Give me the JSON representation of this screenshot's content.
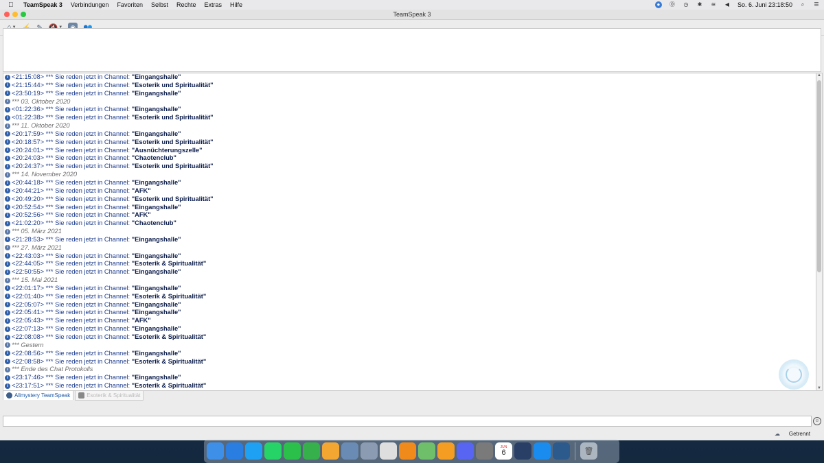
{
  "menubar": {
    "app_name": "TeamSpeak 3",
    "items": [
      "Verbindungen",
      "Favoriten",
      "Selbst",
      "Rechte",
      "Extras",
      "Hilfe"
    ],
    "datetime": "So. 6. Juni  23:18:50"
  },
  "window": {
    "title": "TeamSpeak 3"
  },
  "log": [
    {
      "time": "<21:15:08>",
      "text": "*** Sie reden jetzt in Channel: ",
      "channel": "\"Eingangshalle\""
    },
    {
      "time": "<21:15:44>",
      "text": "*** Sie reden jetzt in Channel: ",
      "channel": "\"Esoterik und Spiritualität\""
    },
    {
      "time": "<23:50:19>",
      "text": "*** Sie reden jetzt in Channel: ",
      "channel": "\"Eingangshalle\""
    },
    {
      "sep": "*** 03. Oktober 2020"
    },
    {
      "time": "<01:22:36>",
      "text": "*** Sie reden jetzt in Channel: ",
      "channel": "\"Eingangshalle\""
    },
    {
      "time": "<01:22:38>",
      "text": "*** Sie reden jetzt in Channel: ",
      "channel": "\"Esoterik und Spiritualität\""
    },
    {
      "sep": "*** 11. Oktober 2020"
    },
    {
      "time": "<20:17:59>",
      "text": "*** Sie reden jetzt in Channel: ",
      "channel": "\"Eingangshalle\""
    },
    {
      "time": "<20:18:57>",
      "text": "*** Sie reden jetzt in Channel: ",
      "channel": "\"Esoterik und Spiritualität\""
    },
    {
      "time": "<20:24:01>",
      "text": "*** Sie reden jetzt in Channel: ",
      "channel": "\"Ausnüchterungszelle\""
    },
    {
      "time": "<20:24:03>",
      "text": "*** Sie reden jetzt in Channel: ",
      "channel": "\"Chaotenclub\""
    },
    {
      "time": "<20:24:37>",
      "text": "*** Sie reden jetzt in Channel: ",
      "channel": "\"Esoterik und Spiritualität\""
    },
    {
      "sep": "*** 14. November 2020"
    },
    {
      "time": "<20:44:18>",
      "text": "*** Sie reden jetzt in Channel: ",
      "channel": "\"Eingangshalle\""
    },
    {
      "time": "<20:44:21>",
      "text": "*** Sie reden jetzt in Channel: ",
      "channel": "\"AFK\""
    },
    {
      "time": "<20:49:20>",
      "text": "*** Sie reden jetzt in Channel: ",
      "channel": "\"Esoterik und Spiritualität\""
    },
    {
      "time": "<20:52:54>",
      "text": "*** Sie reden jetzt in Channel: ",
      "channel": "\"Eingangshalle\""
    },
    {
      "time": "<20:52:56>",
      "text": "*** Sie reden jetzt in Channel: ",
      "channel": "\"AFK\""
    },
    {
      "time": "<21:02:20>",
      "text": "*** Sie reden jetzt in Channel: ",
      "channel": "\"Chaotenclub\""
    },
    {
      "sep": "*** 05. März 2021"
    },
    {
      "time": "<21:28:53>",
      "text": "*** Sie reden jetzt in Channel: ",
      "channel": "\"Eingangshalle\""
    },
    {
      "sep": "*** 27. März 2021"
    },
    {
      "time": "<22:43:03>",
      "text": "*** Sie reden jetzt in Channel: ",
      "channel": "\"Eingangshalle\""
    },
    {
      "time": "<22:44:05>",
      "text": "*** Sie reden jetzt in Channel: ",
      "channel": "\"Esoterik & Spiritualität\""
    },
    {
      "time": "<22:50:55>",
      "text": "*** Sie reden jetzt in Channel: ",
      "channel": "\"Eingangshalle\""
    },
    {
      "sep": "*** 15. Mai 2021"
    },
    {
      "time": "<22:01:17>",
      "text": "*** Sie reden jetzt in Channel: ",
      "channel": "\"Eingangshalle\""
    },
    {
      "time": "<22:01:40>",
      "text": "*** Sie reden jetzt in Channel: ",
      "channel": "\"Esoterik & Spiritualität\""
    },
    {
      "time": "<22:05:07>",
      "text": "*** Sie reden jetzt in Channel: ",
      "channel": "\"Eingangshalle\""
    },
    {
      "time": "<22:05:41>",
      "text": "*** Sie reden jetzt in Channel: ",
      "channel": "\"Eingangshalle\""
    },
    {
      "time": "<22:05:43>",
      "text": "*** Sie reden jetzt in Channel: ",
      "channel": "\"AFK\""
    },
    {
      "time": "<22:07:13>",
      "text": "*** Sie reden jetzt in Channel: ",
      "channel": "\"Eingangshalle\""
    },
    {
      "time": "<22:08:08>",
      "text": "*** Sie reden jetzt in Channel: ",
      "channel": "\"Esoterik & Spiritualität\""
    },
    {
      "sep": "*** Gestern"
    },
    {
      "time": "<22:08:56>",
      "text": "*** Sie reden jetzt in Channel: ",
      "channel": "\"Eingangshalle\""
    },
    {
      "time": "<22:08:58>",
      "text": "*** Sie reden jetzt in Channel: ",
      "channel": "\"Esoterik & Spiritualität\""
    },
    {
      "sep": "*** Ende des Chat Protokolls"
    },
    {
      "time": "<23:17:46>",
      "text": "*** Sie reden jetzt in Channel: ",
      "channel": "\"Eingangshalle\""
    },
    {
      "time": "<23:17:51>",
      "text": "*** Sie reden jetzt in Channel: ",
      "channel": "\"Esoterik & Spiritualität\""
    }
  ],
  "tabs": [
    {
      "label": "Allmystery TeamSpeak",
      "active": true
    },
    {
      "label": "Esoterik & Spiritualität",
      "active": false
    }
  ],
  "status": {
    "text": "Getrennt"
  },
  "dock": {
    "calendar_month": "JUN",
    "calendar_day": "6",
    "apps": [
      {
        "icon": "finder-icon",
        "color": "#3d8fe8"
      },
      {
        "icon": "safari-icon",
        "color": "#2a7de1"
      },
      {
        "icon": "messages-icon",
        "color": "#1ea1f2"
      },
      {
        "icon": "whatsapp-icon",
        "color": "#25d366"
      },
      {
        "icon": "facetime-icon",
        "color": "#2bc04a"
      },
      {
        "icon": "find-my-icon",
        "color": "#35b04a"
      },
      {
        "icon": "pages-icon",
        "color": "#f3a732"
      },
      {
        "icon": "preview-icon",
        "color": "#6a8bb3"
      },
      {
        "icon": "image-capture-icon",
        "color": "#8a9bb2"
      },
      {
        "icon": "textedit-icon",
        "color": "#dedede"
      },
      {
        "icon": "vlc-icon",
        "color": "#f08a1a"
      },
      {
        "icon": "maps-icon",
        "color": "#6fbf6a"
      },
      {
        "icon": "home-icon",
        "color": "#f59d23"
      },
      {
        "icon": "discord-icon",
        "color": "#5865f2"
      },
      {
        "icon": "system-preferences-icon",
        "color": "#7a7a7a"
      },
      {
        "icon": "calendar-icon",
        "color": "#ffffff"
      },
      {
        "icon": "quicktime-icon",
        "color": "#2a3f66"
      },
      {
        "icon": "app-store-icon",
        "color": "#1a8cf0"
      },
      {
        "icon": "teamspeak-icon",
        "color": "#2d5a8c"
      }
    ]
  }
}
